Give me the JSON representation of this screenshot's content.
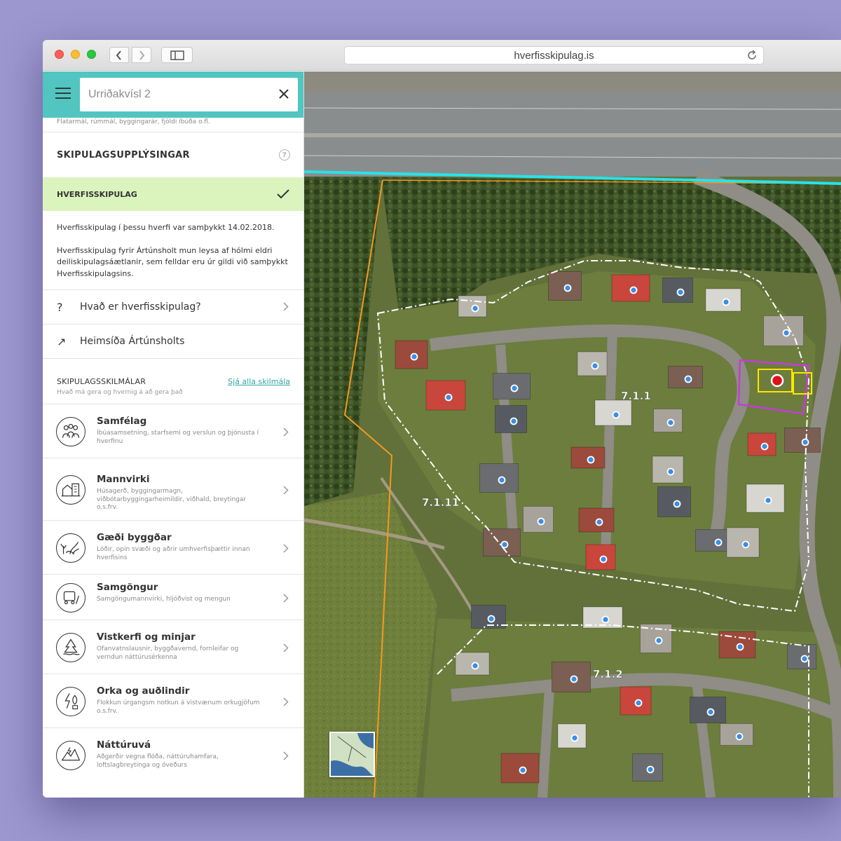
{
  "browser": {
    "url": "hverfisskipulag.is"
  },
  "search": {
    "value": "Urriðakvísl 2"
  },
  "sidebar": {
    "faint_text": "Flatarmál, rúmmál, byggingarár, fjöldi íbúða o.fl.",
    "section_title": "SKIPULAGSUPPLÝSINGAR",
    "help_glyph": "?",
    "active_plan": "HVERFISSKIPULAG",
    "description_1": "Hverfisskipulag í þessu hverfi var samþykkt 14.02.2018.",
    "description_2": "Hverfisskipulag fyrir Ártúnsholt mun leysa af hólmi eldri deiliskipulagsáætlanir, sem felldar eru úr gildi við samþykkt Hverfisskipulagsins.",
    "links": [
      {
        "icon": "?",
        "label": "Hvað er hverfisskipulag?"
      },
      {
        "icon": "↗",
        "label": "Heimsíða Ártúnsholts"
      }
    ],
    "terms_title": "SKIPULAGSSKILMÁLAR",
    "terms_subtitle": "Hvað má gera og hvernig á að gera það",
    "terms_link": "Sjá alla skilmála",
    "categories": [
      {
        "title": "Samfélag",
        "desc": "Íbúasamsetning, starfsemi og verslun og þjónusta í hverfinu",
        "icon": "community-icon"
      },
      {
        "title": "Mannvirki",
        "desc": "Húsagerð, byggingarmagn, viðbótarbyggingarheimildir, viðhald, breytingar o.s.frv.",
        "icon": "buildings-icon"
      },
      {
        "title": "Gæði byggðar",
        "desc": "Lóðir, opin svæði og aðrir umhverfisþættir innan hverfisins",
        "icon": "quality-icon"
      },
      {
        "title": "Samgöngur",
        "desc": "Samgöngumannvirki, hljóðvist og mengun",
        "icon": "transport-icon"
      },
      {
        "title": "Vistkerfi og minjar",
        "desc": "Ofanvatnslausnir, byggðavernd, fornleifar og verndun náttúrusérkenna",
        "icon": "ecosystem-icon"
      },
      {
        "title": "Orka og auðlindir",
        "desc": "Flokkun úrgangsm notkun á vistvænum orkugjöfum o.s.frv.",
        "icon": "energy-icon"
      },
      {
        "title": "Náttúruvá",
        "desc": "Aðgerðir vegna flóða, náttúruhamfara, loftslagbreytinga og óveðurs",
        "icon": "hazard-icon"
      }
    ]
  },
  "map": {
    "zone_labels": [
      "7.1.1",
      "7.1.11",
      "7.1.2"
    ]
  },
  "colors": {
    "accent": "#52c5c0",
    "active_row": "#dbf4be",
    "link": "#2fa7a1",
    "boundary_orange": "#f39a1e",
    "boundary_cyan": "#27e3e8",
    "selection_magenta": "#c53cd6",
    "marker_blue": "#3b8ee6",
    "marker_red": "#e0101b"
  }
}
